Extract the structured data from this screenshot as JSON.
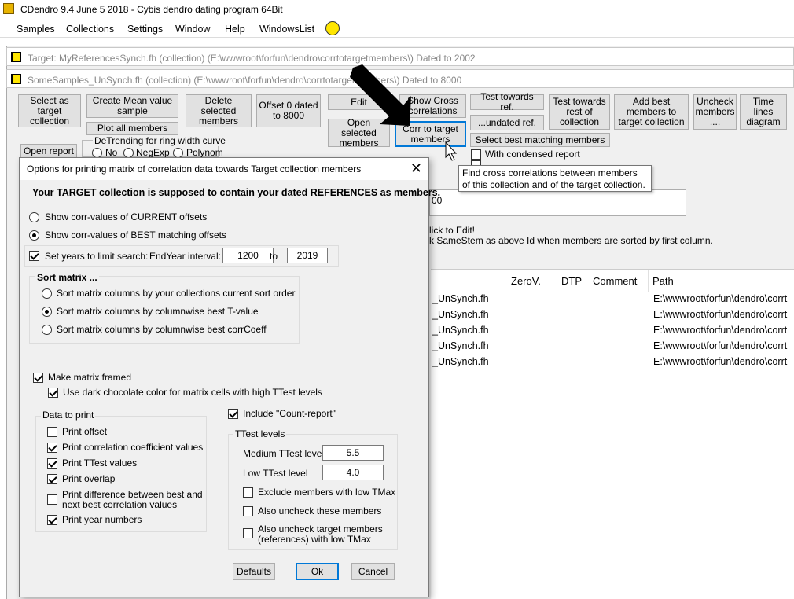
{
  "window": {
    "title": "CDendro 9.4  June 5 2018 - Cybis dendro dating program  64Bit"
  },
  "menu": [
    "Samples",
    "Collections",
    "Settings",
    "Window",
    "Help",
    "WindowsList"
  ],
  "child_windows": {
    "target": "Target: MyReferencesSynch.fh (collection)  (E:\\wwwroot\\forfun\\dendro\\corrtotargetmembers\\) Dated to 2002",
    "samples": "SomeSamples_UnSynch.fh (collection)  (E:\\wwwroot\\forfun\\dendro\\corrtotargetmembers\\) Dated to 8000"
  },
  "toolbar": {
    "select_target": "Select as target collection",
    "create_mean": "Create Mean value sample",
    "plot_all": "Plot all members",
    "delete_selected": "Delete selected members",
    "offset0": "Offset 0 dated to 8000",
    "edit": "Edit",
    "open_selected": "Open selected members",
    "show_cross": "Show Cross correlations",
    "corr_target": "Corr to target members",
    "test_towards_ref": "Test towards ref.",
    "undated_ref": "...undated ref.",
    "select_best": "Select best matching members",
    "test_rest": "Test towards rest of collection",
    "add_best": "Add best members to target collection",
    "uncheck_members": "Uncheck members ....",
    "time_lines": "Time lines diagram",
    "open_report": "Open report",
    "detrend_label": "DeTrending for ring width curve",
    "detrend_no": "No",
    "detrend_negexp": "NegExp",
    "detrend_polynom": "Polynom",
    "with_condensed": "With condensed report"
  },
  "background_text": {
    "click_edit": "lick to Edit!",
    "samestem": "k SameStem as above Id when members are sorted by first column.",
    "partial_field": "00"
  },
  "tooltip": "Find cross correlations between members of this collection and of the target collection.",
  "list": {
    "headers": [
      "ZeroV.",
      "DTP",
      "Comment",
      "Path"
    ],
    "rows": [
      {
        "name": "_UnSynch.fh",
        "path": "E:\\wwwroot\\forfun\\dendro\\corrt"
      },
      {
        "name": "_UnSynch.fh",
        "path": "E:\\wwwroot\\forfun\\dendro\\corrt"
      },
      {
        "name": "_UnSynch.fh",
        "path": "E:\\wwwroot\\forfun\\dendro\\corrt"
      },
      {
        "name": "_UnSynch.fh",
        "path": "E:\\wwwroot\\forfun\\dendro\\corrt"
      },
      {
        "name": "_UnSynch.fh",
        "path": "E:\\wwwroot\\forfun\\dendro\\corrt"
      }
    ]
  },
  "dialog": {
    "title": "Options for printing matrix of correlation data towards Target  collection members",
    "heading": "Your TARGET collection is supposed to contain your dated REFERENCES as members.",
    "radio_current": "Show corr-values of CURRENT offsets",
    "radio_best": "Show corr-values of BEST matching offsets",
    "limit_label": "Set years to limit search:",
    "endyear_label": "EndYear interval:",
    "endyear_from": "1200",
    "to_label": "to",
    "endyear_to": "2019",
    "sort_title": "Sort matrix ...",
    "sort_current": "Sort matrix columns by your collections current sort order",
    "sort_tvalue": "Sort matrix columns by columnwise best T-value",
    "sort_corr": "Sort matrix columns by columnwise best corrCoeff",
    "framed": "Make matrix framed",
    "dark_choc": "Use dark chocolate color for matrix cells with high TTest levels",
    "data_title": "Data to print",
    "print_offset": "Print offset",
    "print_corr": "Print correlation coefficient values",
    "print_ttest": "Print TTest values",
    "print_overlap": "Print overlap",
    "print_diff_1": "Print difference between best and",
    "print_diff_2": "next best correlation values",
    "print_year": "Print year numbers",
    "include_count": "Include \"Count-report\"",
    "ttest_title": "TTest levels",
    "medium_label": "Medium TTest level",
    "medium_value": "5.5",
    "low_label": "Low TTest level",
    "low_value": "4.0",
    "exclude_low": "Exclude members with low TMax",
    "also_uncheck": "Also uncheck these members",
    "also_uncheck_target_1": "Also uncheck target members",
    "also_uncheck_target_2": "(references) with low TMax",
    "defaults": "Defaults",
    "ok": "Ok",
    "cancel": "Cancel"
  }
}
